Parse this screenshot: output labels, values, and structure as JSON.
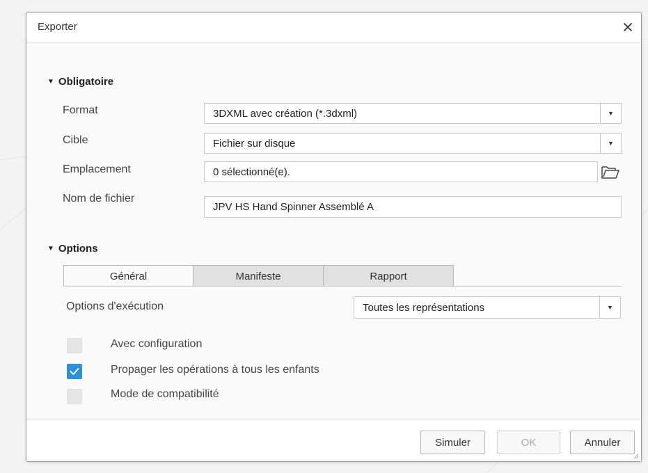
{
  "dialog": {
    "title": "Exporter",
    "close_icon": "close-icon"
  },
  "mandatory": {
    "header": "Obligatoire",
    "format_label": "Format",
    "format_value": "3DXML avec création (*.3dxml)",
    "target_label": "Cible",
    "target_value": "Fichier sur disque",
    "location_label": "Emplacement",
    "location_value": "0 sélectionné(e).",
    "filename_label": "Nom de fichier",
    "filename_value": "JPV HS Hand Spinner Assemblé A"
  },
  "options": {
    "header": "Options",
    "tabs": [
      {
        "label": "Général",
        "active": true
      },
      {
        "label": "Manifeste",
        "active": false
      },
      {
        "label": "Rapport",
        "active": false
      }
    ],
    "execution_label": "Options d'exécution",
    "execution_value": "Toutes les représentations",
    "checkboxes": [
      {
        "label": "Avec configuration",
        "checked": false
      },
      {
        "label": "Propager les opérations à tous les enfants",
        "checked": true
      },
      {
        "label": "Mode de compatibilité",
        "checked": false
      }
    ]
  },
  "footer": {
    "simulate_label": "Simuler",
    "ok_label": "OK",
    "cancel_label": "Annuler"
  },
  "colors": {
    "accent": "#2d8ed9",
    "tab_inactive": "#e1e1e1",
    "border": "#c8c8c8"
  }
}
